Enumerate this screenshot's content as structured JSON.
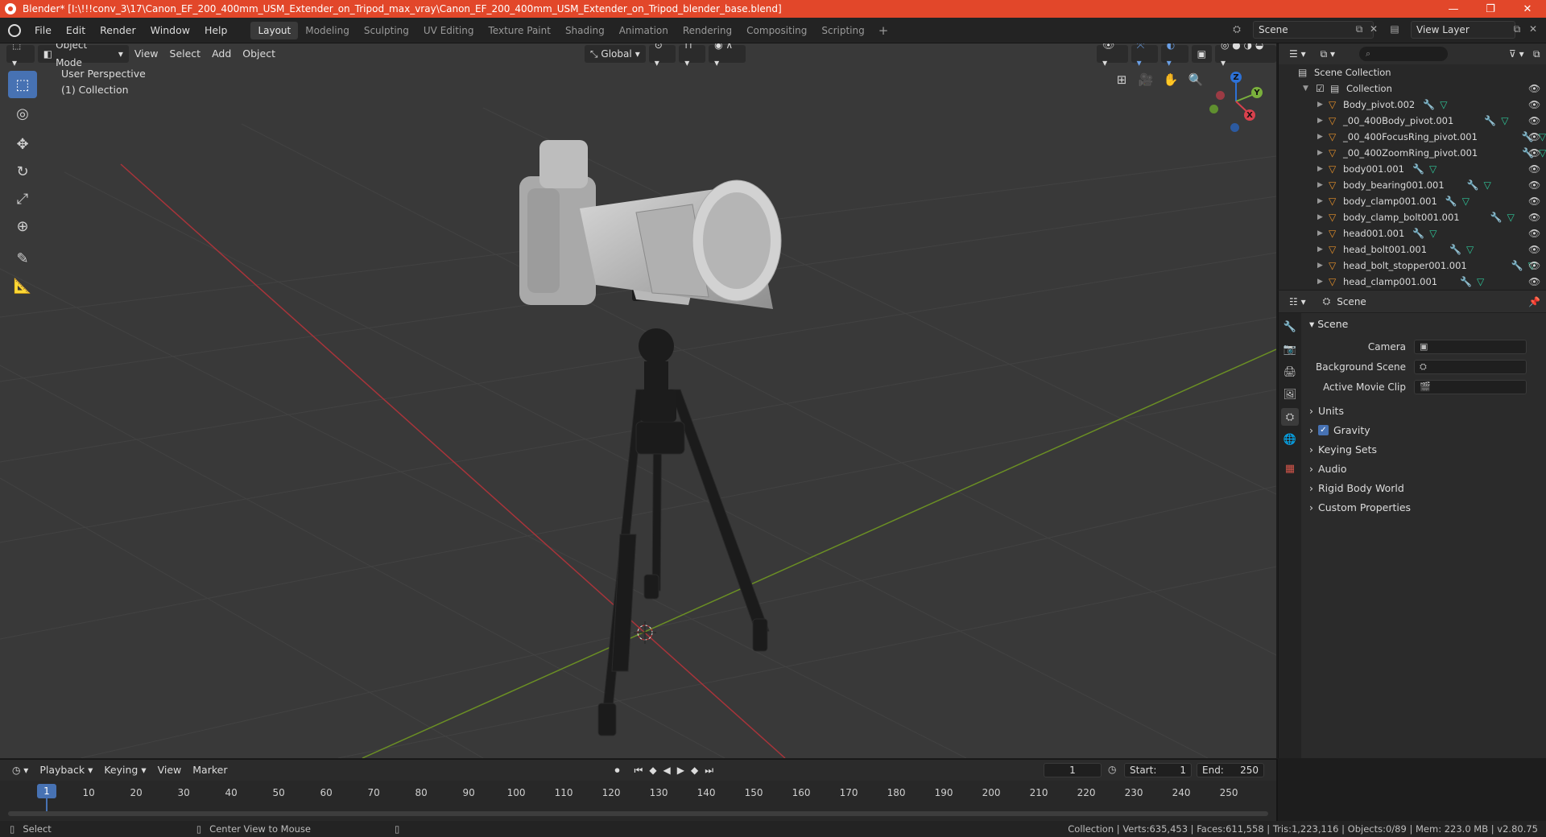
{
  "window": {
    "title": "Blender* [I:\\!!!conv_3\\17\\Canon_EF_200_400mm_USM_Extender_on_Tripod_max_vray\\Canon_EF_200_400mm_USM_Extender_on_Tripod_blender_base.blend]",
    "minimize": "—",
    "restore": "❐",
    "close": "✕"
  },
  "menu": [
    "File",
    "Edit",
    "Render",
    "Window",
    "Help"
  ],
  "workspaces": [
    {
      "label": "Layout",
      "active": true
    },
    {
      "label": "Modeling"
    },
    {
      "label": "Sculpting"
    },
    {
      "label": "UV Editing"
    },
    {
      "label": "Texture Paint"
    },
    {
      "label": "Shading"
    },
    {
      "label": "Animation"
    },
    {
      "label": "Rendering"
    },
    {
      "label": "Compositing"
    },
    {
      "label": "Scripting"
    }
  ],
  "add_workspace": "+",
  "scene_field": "Scene",
  "view_layer_field": "View Layer",
  "viewport": {
    "mode": "Object Mode",
    "menus": [
      "View",
      "Select",
      "Add",
      "Object"
    ],
    "orientation": "Global",
    "info_line1": "User Perspective",
    "info_line2": "(1) Collection",
    "gizmo": {
      "x": "X",
      "y": "Y",
      "z": "Z"
    }
  },
  "outliner": {
    "root": "Scene Collection",
    "collection": "Collection",
    "items": [
      "Body_pivot.002",
      "_00_400Body_pivot.001",
      "_00_400FocusRing_pivot.001",
      "_00_400ZoomRing_pivot.001",
      "body001.001",
      "body_bearing001.001",
      "body_clamp001.001",
      "body_clamp_bolt001.001",
      "head001.001",
      "head_bolt001.001",
      "head_bolt_stopper001.001",
      "head_clamp001.001"
    ]
  },
  "properties": {
    "header": "Scene",
    "panel": "Scene",
    "camera_label": "Camera",
    "bg_scene_label": "Background Scene",
    "movie_clip_label": "Active Movie Clip",
    "sections": [
      "Units",
      "Gravity",
      "Keying Sets",
      "Audio",
      "Rigid Body World",
      "Custom Properties"
    ]
  },
  "timeline": {
    "menus": [
      "Playback",
      "Keying",
      "View",
      "Marker"
    ],
    "current_frame": "1",
    "start_label": "Start:",
    "start": "1",
    "end_label": "End:",
    "end": "250",
    "ticks": [
      "10",
      "20",
      "30",
      "40",
      "50",
      "60",
      "70",
      "80",
      "90",
      "100",
      "110",
      "120",
      "130",
      "140",
      "150",
      "160",
      "170",
      "180",
      "190",
      "200",
      "210",
      "220",
      "230",
      "240",
      "250"
    ]
  },
  "status": {
    "select": "Select",
    "center": "Center View to Mouse",
    "stats": "Collection | Verts:635,453 | Faces:611,558 | Tris:1,223,116 | Objects:0/89 | Mem: 223.0 MB | v2.80.75"
  }
}
